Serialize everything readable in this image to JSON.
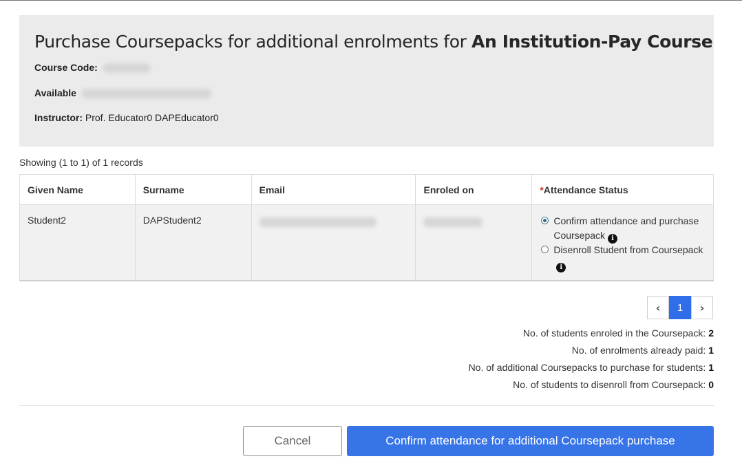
{
  "header": {
    "title_prefix": "Purchase Coursepacks for additional enrolments for ",
    "title_course": "An Institution-Pay Course",
    "course_code_label": "Course Code:",
    "available_label": "Available",
    "instructor_label": "Instructor:",
    "instructor_value": " Prof. Educator0 DAPEducator0"
  },
  "records_text": "Showing (1 to 1) of 1 records",
  "table": {
    "columns": [
      "Given Name",
      "Surname",
      "Email",
      "Enroled on",
      "Attendance Status"
    ],
    "required_marker": "*",
    "rows": [
      {
        "given_name": "Student2",
        "surname": "DAPStudent2",
        "attendance_options": [
          {
            "label": "Confirm attendance and purchase Coursepack",
            "selected": true
          },
          {
            "label": "Disenroll Student from Coursepack",
            "selected": false
          }
        ]
      }
    ]
  },
  "pagination": {
    "current_page": "1",
    "prev_glyph": "‹",
    "next_glyph": "›"
  },
  "stats": [
    {
      "label": "No. of students enroled in the Coursepack: ",
      "value": "2"
    },
    {
      "label": "No. of enrolments already paid: ",
      "value": "1"
    },
    {
      "label": "No. of additional Coursepacks to purchase for students: ",
      "value": "1"
    },
    {
      "label": "No. of students to disenroll from Coursepack: ",
      "value": "0"
    }
  ],
  "buttons": {
    "cancel": "Cancel",
    "confirm": "Confirm attendance for additional Coursepack purchase"
  },
  "icons": {
    "info": "info-icon"
  },
  "colors": {
    "primary": "#3674e8",
    "header_bg": "#ebebeb",
    "row_bg": "#f1f1f1",
    "required": "#c0392b"
  }
}
